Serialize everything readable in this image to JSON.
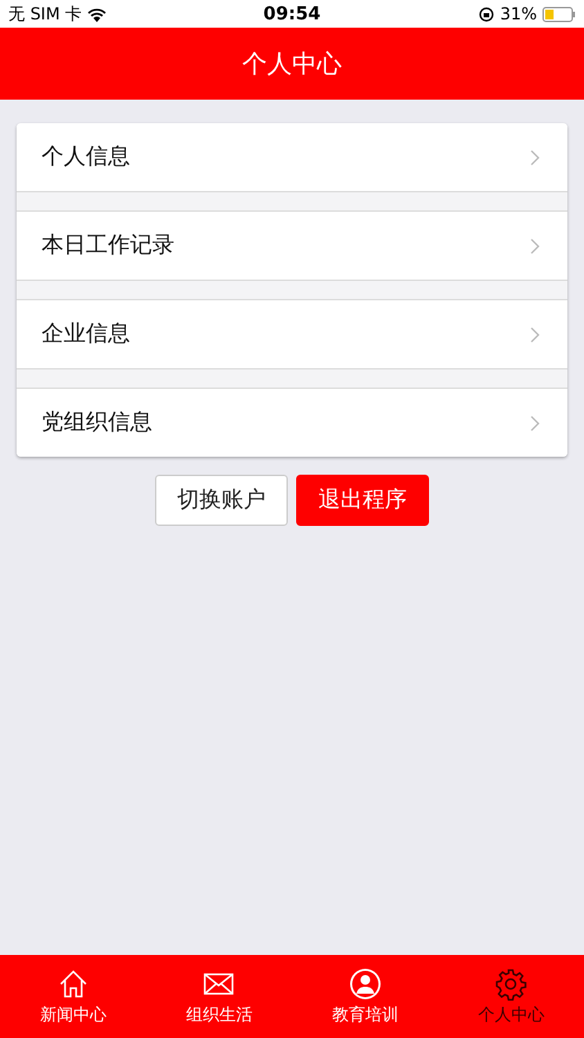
{
  "status_bar": {
    "carrier": "无 SIM 卡",
    "time": "09:54",
    "battery": "31%"
  },
  "header": {
    "title": "个人中心"
  },
  "menu": [
    {
      "label": "个人信息"
    },
    {
      "label": "本日工作记录"
    },
    {
      "label": "企业信息"
    },
    {
      "label": "党组织信息"
    }
  ],
  "buttons": [
    {
      "label": "切换账户",
      "kind": "secondary"
    },
    {
      "label": "退出程序",
      "kind": "primary"
    }
  ],
  "tab_bar": [
    {
      "label": "新闻中心",
      "selected": false
    },
    {
      "label": "组织生活",
      "selected": false
    },
    {
      "label": "教育培训",
      "selected": false
    },
    {
      "label": "个人中心",
      "selected": true
    }
  ]
}
